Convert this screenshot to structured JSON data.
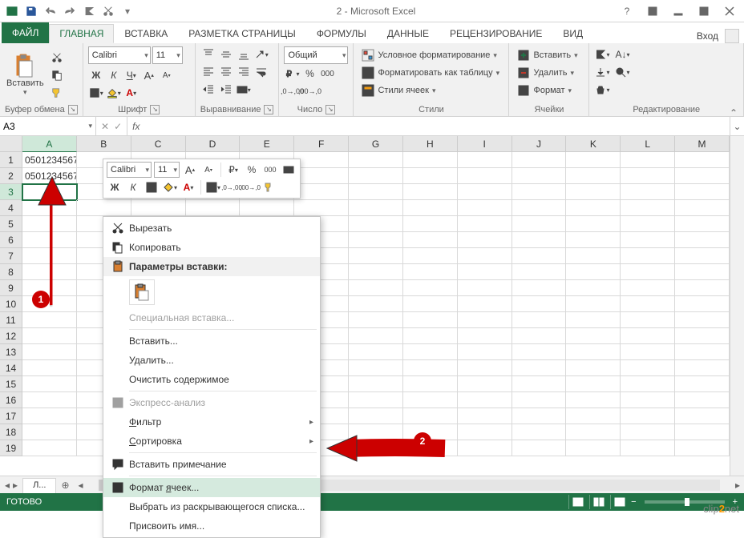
{
  "title": "2 - Microsoft Excel",
  "signin": "Вход",
  "tabs": {
    "file": "ФАЙЛ",
    "home": "ГЛАВНАЯ",
    "insert": "ВСТАВКА",
    "page_layout": "РАЗМЕТКА СТРАНИЦЫ",
    "formulas": "ФОРМУЛЫ",
    "data": "ДАННЫЕ",
    "review": "РЕЦЕНЗИРОВАНИЕ",
    "view": "ВИД"
  },
  "ribbon": {
    "clipboard": {
      "paste": "Вставить",
      "title": "Буфер обмена"
    },
    "font": {
      "name": "Calibri",
      "size": "11",
      "title": "Шрифт",
      "bold": "Ж",
      "italic": "К",
      "underline": "Ч"
    },
    "alignment": {
      "title": "Выравнивание"
    },
    "number": {
      "format": "Общий",
      "title": "Число"
    },
    "styles": {
      "cond": "Условное форматирование",
      "table": "Форматировать как таблицу",
      "cell": "Стили ячеек",
      "title": "Стили"
    },
    "cells": {
      "insert": "Вставить",
      "delete": "Удалить",
      "format": "Формат",
      "title": "Ячейки"
    },
    "editing": {
      "title": "Редактирование"
    }
  },
  "name_box": "A3",
  "fx_label": "fx",
  "columns": [
    "A",
    "B",
    "C",
    "D",
    "E",
    "F",
    "G",
    "H",
    "I",
    "J",
    "K",
    "L",
    "M"
  ],
  "rows": [
    1,
    2,
    3,
    4,
    5,
    6,
    7,
    8,
    9,
    10,
    11,
    12,
    13,
    14,
    15,
    16,
    17,
    18,
    19
  ],
  "cell_A1": "0501234567",
  "cell_A2": "0501234567",
  "sheet_tab": "Л...",
  "status_ready": "ГОТОВО",
  "mini_toolbar": {
    "font": "Calibri",
    "size": "11",
    "bold": "Ж",
    "italic": "К"
  },
  "context_menu": {
    "cut": "Вырезать",
    "copy": "Копировать",
    "paste_header": "Параметры вставки:",
    "paste_special": "Специальная вставка...",
    "insert": "Вставить...",
    "delete": "Удалить...",
    "clear": "Очистить содержимое",
    "quick_analysis": "Экспресс-анализ",
    "filter": "Фильтр",
    "sort": "Сортировка",
    "comment": "Вставить примечание",
    "format_cells": "Формат ячеек...",
    "dropdown": "Выбрать из раскрывающегося списка...",
    "name": "Присвоить имя...",
    "underline_f": "Ф",
    "underline_s": "С",
    "underline_ya": "я"
  },
  "badges": {
    "one": "1",
    "two": "2"
  },
  "watermark_pre": "clip",
  "watermark_mid": "2",
  "watermark_post": "net"
}
